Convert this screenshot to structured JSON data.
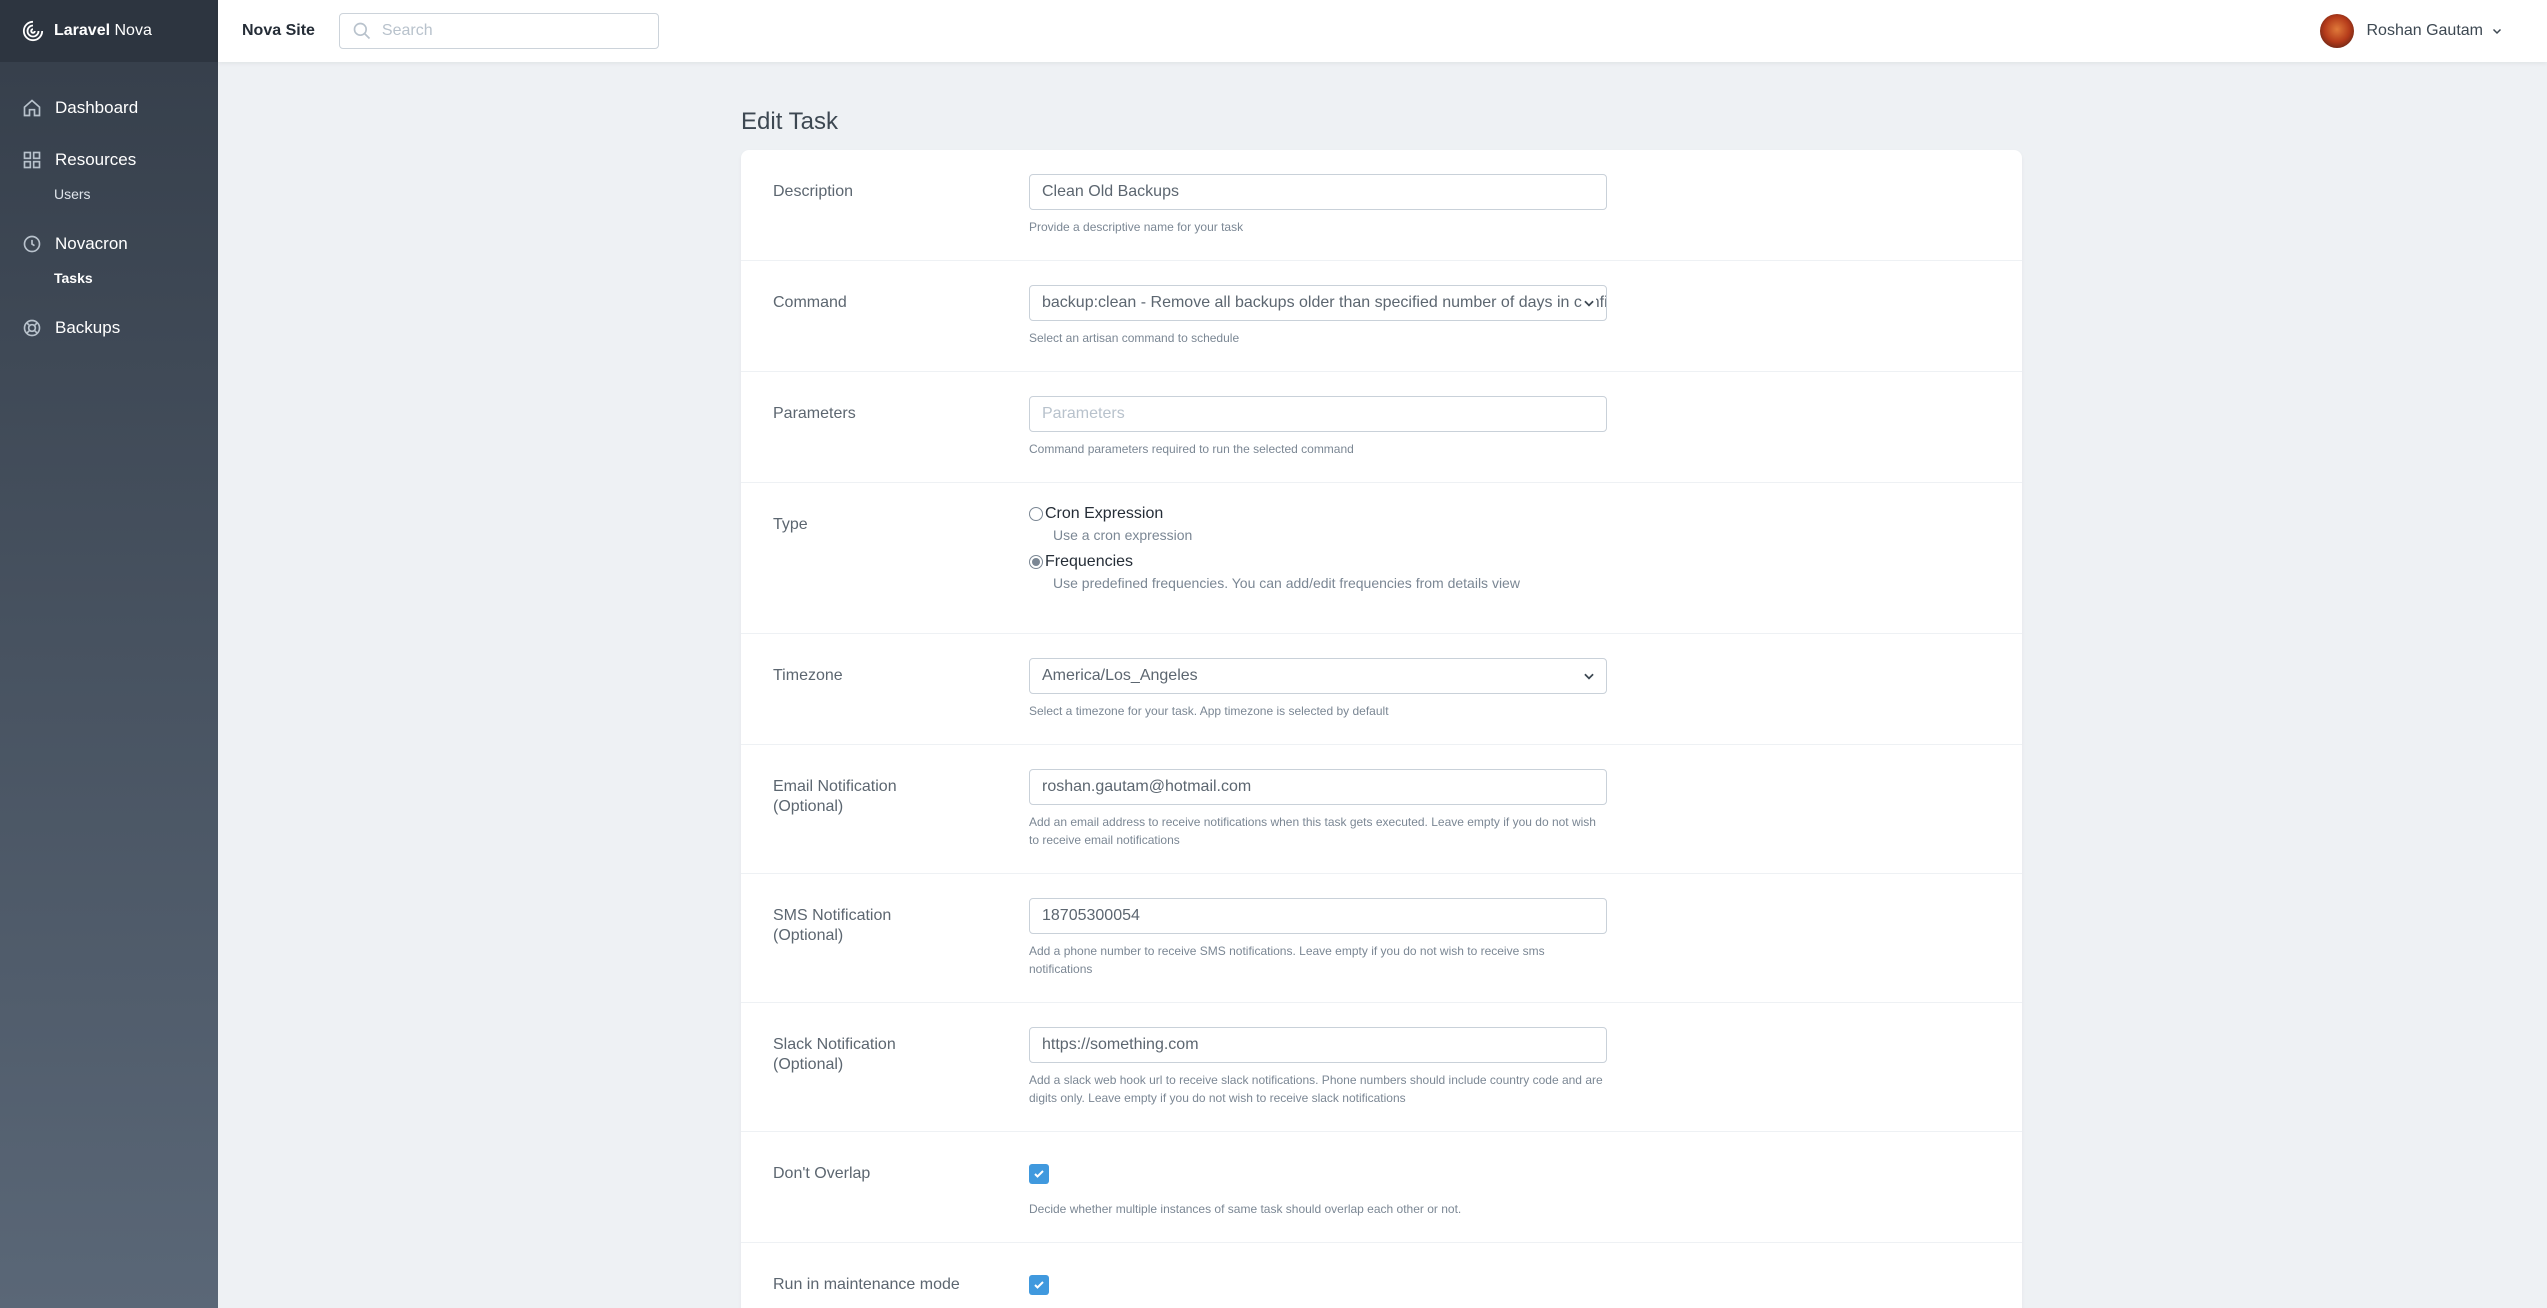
{
  "brand": {
    "name_bold": "Laravel",
    "name_rest": " Nova"
  },
  "sidebar": {
    "items": [
      {
        "label": "Dashboard",
        "icon": "home-icon"
      },
      {
        "label": "Resources",
        "icon": "grid-icon"
      },
      {
        "label": "Users",
        "icon": ""
      },
      {
        "label": "Novacron",
        "icon": "clock-icon"
      },
      {
        "label": "Tasks",
        "icon": "",
        "active": true
      },
      {
        "label": "Backups",
        "icon": "lifebuoy-icon"
      }
    ]
  },
  "topbar": {
    "site_name": "Nova Site",
    "search_placeholder": "Search",
    "user_name": "Roshan Gautam"
  },
  "page": {
    "title": "Edit Task"
  },
  "form": {
    "description": {
      "label": "Description",
      "value": "Clean Old Backups",
      "help": "Provide a descriptive name for your task"
    },
    "command": {
      "label": "Command",
      "value": "backup:clean - Remove all backups older than specified number of days in config.",
      "help": "Select an artisan command to schedule"
    },
    "parameters": {
      "label": "Parameters",
      "placeholder": "Parameters",
      "help": "Command parameters required to run the selected command"
    },
    "type": {
      "label": "Type",
      "options": [
        {
          "label": "Cron Expression",
          "help": "Use a cron expression",
          "checked": false
        },
        {
          "label": "Frequencies",
          "help": "Use predefined frequencies. You can add/edit frequencies from details view",
          "checked": true
        }
      ]
    },
    "timezone": {
      "label": "Timezone",
      "value": "America/Los_Angeles",
      "help": "Select a timezone for your task. App timezone is selected by default"
    },
    "email": {
      "label_line1": "Email Notification",
      "label_line2": "(Optional)",
      "value": "roshan.gautam@hotmail.com",
      "help": "Add an email address to receive notifications when this task gets executed. Leave empty if you do not wish to receive email notifications"
    },
    "sms": {
      "label_line1": "SMS Notification",
      "label_line2": "(Optional)",
      "value": "18705300054",
      "help": "Add a phone number to receive SMS notifications. Leave empty if you do not wish to receive sms notifications"
    },
    "slack": {
      "label_line1": "Slack Notification",
      "label_line2": "(Optional)",
      "value": "https://something.com",
      "help": "Add a slack web hook url to receive slack notifications. Phone numbers should include country code and are digits only. Leave empty if you do not wish to receive slack notifications"
    },
    "dont_overlap": {
      "label": "Don't Overlap",
      "checked": true,
      "help": "Decide whether multiple instances of same task should overlap each other or not."
    },
    "maintenance": {
      "label": "Run in maintenance mode",
      "checked": true
    }
  },
  "colors": {
    "accent": "#4099de",
    "sidebar_top": "#353e4a",
    "sidebar_bottom": "#5a6777"
  }
}
